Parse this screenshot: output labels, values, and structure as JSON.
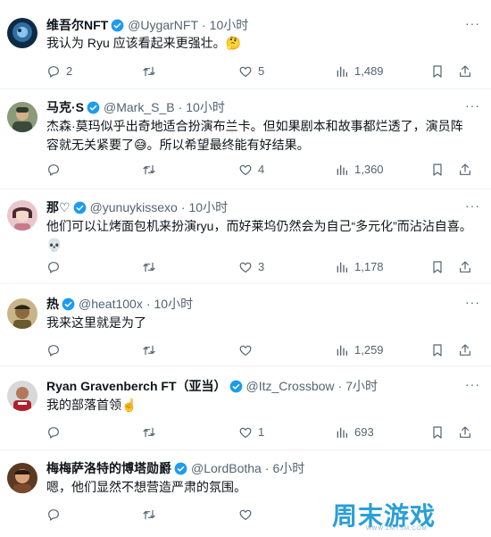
{
  "tweets": [
    {
      "name": "维吾尔NFT",
      "handle": "@UygarNFT",
      "time": "10小时",
      "text": "我认为 Ryu 应该看起来更强壮。🤔",
      "replies": "2",
      "retweets": "",
      "likes": "5",
      "views": "1,489",
      "avatar_color": "#1d4f7a"
    },
    {
      "name": "马克·S",
      "handle": "@Mark_S_B",
      "time": "10小时",
      "text": "杰森·莫玛似乎出奇地适合扮演布兰卡。但如果剧本和故事都烂透了，演员阵容就无关紧要了😅。所以希望最终能有好结果。",
      "replies": "",
      "retweets": "",
      "likes": "4",
      "views": "1,360",
      "avatar_color": "#3b4a3a"
    },
    {
      "name": "那♡",
      "handle": "@yunuykissexo",
      "time": "10小时",
      "text": "他们可以让烤面包机来扮演ryu，而好莱坞仍然会为自己“多元化”而沾沾自喜。💀",
      "replies": "",
      "retweets": "",
      "likes": "3",
      "views": "1,178",
      "avatar_color": "#c77b8a"
    },
    {
      "name": "热",
      "handle": "@heat100x",
      "time": "10小时",
      "text": "我来这里就是为了",
      "replies": "",
      "retweets": "",
      "likes": "",
      "views": "1,259",
      "avatar_color": "#6b5a2e"
    },
    {
      "name": "Ryan Gravenberch FT（亚当）",
      "handle": "@Itz_Crossbow",
      "time": "7小时",
      "text": "我的部落首领☝️",
      "replies": "",
      "retweets": "",
      "likes": "1",
      "views": "693",
      "avatar_color": "#8a1f2a"
    },
    {
      "name": "梅梅萨洛特的博塔勋爵",
      "handle": "@LordBotha",
      "time": "6小时",
      "text": "嗯，他们显然不想营造严肃的氛围。",
      "replies": "",
      "retweets": "",
      "likes": "",
      "views": "",
      "avatar_color": "#7a4a2a"
    }
  ],
  "colors": {
    "verified": "#1d9bf0",
    "muted": "#536471",
    "divider": "#eff3f4",
    "watermark": "#2a9fd6"
  },
  "watermark": {
    "text": "周末游戏",
    "url": "WWW.ZMYSM.COM"
  }
}
